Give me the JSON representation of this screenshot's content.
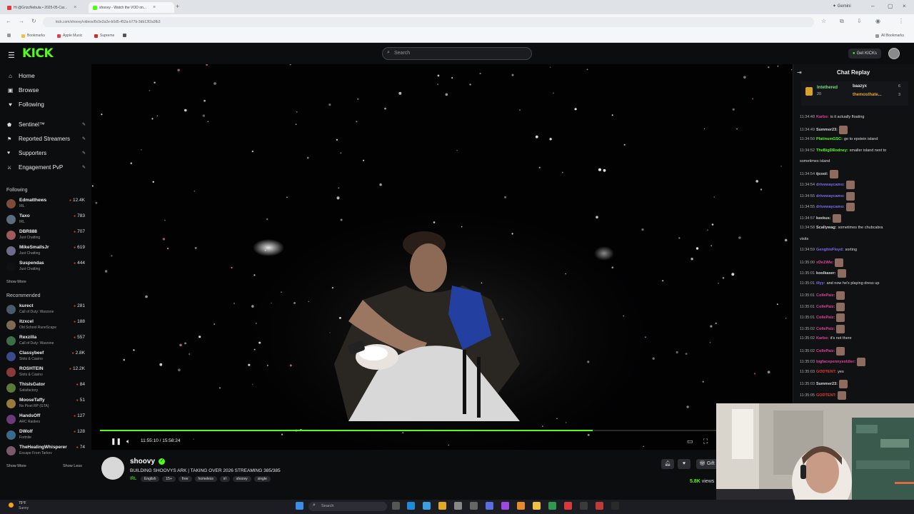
{
  "browser": {
    "tabs": [
      {
        "label": "Hi @GrizzNebula • 2025-05-Car..."
      },
      {
        "label": "shoovy - Watch the VOD on..."
      }
    ],
    "gemini_label": "Gemini",
    "url": "kick.com/shoovy/videos/8c0e2a2e-b0d5-452a-b77b-3db13f2a3fb3",
    "bookmarks": [
      "Bookmarks",
      "Apple Music",
      "Supreme"
    ],
    "all_bookmarks": "All Bookmarks"
  },
  "header": {
    "logo": "KICK",
    "search_placeholder": "Search",
    "get_kicks": "Get KICKs"
  },
  "sidebar": {
    "nav": [
      {
        "label": "Home",
        "icon": "home-icon"
      },
      {
        "label": "Browse",
        "icon": "browse-icon"
      },
      {
        "label": "Following",
        "icon": "heart-icon"
      }
    ],
    "extras": [
      {
        "label": "Sentinel™",
        "icon": "shield-icon"
      },
      {
        "label": "Reported Streamers",
        "icon": "flag-icon"
      },
      {
        "label": "Supporters",
        "icon": "heart-icon"
      },
      {
        "label": "Engagement PvP",
        "icon": "swords-icon"
      }
    ],
    "following_title": "Following",
    "following": [
      {
        "name": "Edmatthews",
        "category": "IRL",
        "viewers": "12.4K",
        "color": "#7a4e3a"
      },
      {
        "name": "Taxo",
        "category": "IRL",
        "viewers": "783",
        "color": "#5b6c7d"
      },
      {
        "name": "DBR888",
        "category": "Just Chatting",
        "viewers": "707",
        "color": "#a05a5a"
      },
      {
        "name": "MikeSmallsJr",
        "category": "Just Chatting",
        "viewers": "619",
        "color": "#6d6d8a"
      },
      {
        "name": "Suspendas",
        "category": "Just Chatting",
        "viewers": "444",
        "color": "#111111"
      }
    ],
    "show_more": "Show More",
    "recommended_title": "Recommended",
    "recommended": [
      {
        "name": "kurect",
        "category": "Call of Duty: Warzone",
        "viewers": "281",
        "color": "#4a5a6a"
      },
      {
        "name": "itzxcel",
        "category": "Old School RuneScape",
        "viewers": "188",
        "color": "#7d6a50"
      },
      {
        "name": "Rexzilla",
        "category": "Call of Duty: Warzone",
        "viewers": "557",
        "color": "#3c6e4a"
      },
      {
        "name": "Classybeef",
        "category": "Slots & Casino",
        "viewers": "2.8K",
        "color": "#3a4a8a"
      },
      {
        "name": "ROSHTEIN",
        "category": "Slots & Casino",
        "viewers": "12.2K",
        "color": "#8a3a3a"
      },
      {
        "name": "ThisIsGator",
        "category": "Satisfactory",
        "viewers": "84",
        "color": "#5a7a3a"
      },
      {
        "name": "MooseTaffy",
        "category": "No Pixel RP (GTA)",
        "viewers": "51",
        "color": "#9a7a3a"
      },
      {
        "name": "HandsOff",
        "category": "ARC Raiders",
        "viewers": "127",
        "color": "#6a3a7a"
      },
      {
        "name": "DWolf",
        "category": "Fortnite",
        "viewers": "128",
        "color": "#3a6a8a"
      },
      {
        "name": "TheHealingWhisperer",
        "category": "Escape From Tarkov",
        "viewers": "74",
        "color": "#7a5a6a"
      }
    ],
    "show_more_2": "Show More",
    "show_less": "Show Less"
  },
  "player": {
    "timecode": "11:55:10 / 15:58:24",
    "progress": 0.797
  },
  "stream": {
    "streamer": "shoovy",
    "title": "BUILDING SHOOVYS ARK | TAKING OVER 2026 STREAMING 385/385",
    "category": "IRL",
    "tags": [
      "English",
      "15+",
      "free",
      "homeless",
      "irl",
      "shoovy",
      "single"
    ],
    "gift_label": "Gift",
    "viewers_count": "5.8K",
    "viewers_label": "views"
  },
  "chat": {
    "title": "Chat Replay",
    "pinned": [
      {
        "user": "Intethered",
        "amount": "20"
      },
      {
        "user": "baazyx",
        "amount": "6"
      },
      {
        "user": "themosthate...",
        "amount": "3"
      }
    ],
    "messages": [
      {
        "time": "11:34:48",
        "user": "Karbo:",
        "color": "#e0409a",
        "text": "is it actually floating"
      },
      {
        "time": "11:34:49",
        "user": "Summer23:",
        "color": "#d8d8d8",
        "text": ""
      },
      {
        "time": "11:34:50",
        "user": "PlatinumGSC:",
        "color": "#53fc18",
        "text": "go to epstein island"
      },
      {
        "time": "11:34:52",
        "user": "TheBigDRodney:",
        "color": "#53fc18",
        "text": "smaller island next to"
      },
      {
        "time": "",
        "user": "",
        "color": "#d8d8d8",
        "text": "sometimes island"
      },
      {
        "time": "11:34:54",
        "user": "tjcool:",
        "color": "#d8d8d8",
        "text": ""
      },
      {
        "time": "11:34:54",
        "user": "drivewaycamo:",
        "color": "#7a6cf0",
        "text": ""
      },
      {
        "time": "11:34:55",
        "user": "drivewaycamo:",
        "color": "#7a6cf0",
        "text": ""
      },
      {
        "time": "11:34:55",
        "user": "drivewaycamo:",
        "color": "#7a6cf0",
        "text": ""
      },
      {
        "time": "11:34:57",
        "user": "keekus:",
        "color": "#d8d8d8",
        "text": ""
      },
      {
        "time": "11:34:58",
        "user": "Scallywag:",
        "color": "#d8d8d8",
        "text": "sometimes the chubcabra"
      },
      {
        "time": "",
        "user": "",
        "color": "#d8d8d8",
        "text": "visits"
      },
      {
        "time": "11:34:59",
        "user": "GenghisFloyd:",
        "color": "#7a6cf0",
        "text": "sorting"
      },
      {
        "time": "11:35:00",
        "user": "xDeZiMe:",
        "color": "#e0409a",
        "text": ""
      },
      {
        "time": "11:35:01",
        "user": "koolkaser:",
        "color": "#d8d8d8",
        "text": ""
      },
      {
        "time": "11:35:01",
        "user": "illyy:",
        "color": "#7a6cf0",
        "text": "and now he's playing dress up"
      },
      {
        "time": "11:35:01",
        "user": "CollePaiz:",
        "color": "#e0409a",
        "text": ""
      },
      {
        "time": "11:35:01",
        "user": "CollePaiz:",
        "color": "#e0409a",
        "text": ""
      },
      {
        "time": "11:35:01",
        "user": "CollePaiz:",
        "color": "#e0409a",
        "text": ""
      },
      {
        "time": "11:35:02",
        "user": "CollePaiz:",
        "color": "#e0409a",
        "text": ""
      },
      {
        "time": "11:35:02",
        "user": "Karbo:",
        "color": "#e0409a",
        "text": "it's not there"
      },
      {
        "time": "11:35:02",
        "user": "CollePaiz:",
        "color": "#e0409a",
        "text": ""
      },
      {
        "time": "11:35:03",
        "user": "bigfacepennysoldier:",
        "color": "#e0409a",
        "text": ""
      },
      {
        "time": "11:35:03",
        "user": "GODTENT:",
        "color": "#e53935",
        "text": "yes"
      },
      {
        "time": "11:35:03",
        "user": "Summer23:",
        "color": "#d8d8d8",
        "text": ""
      },
      {
        "time": "11:35:05",
        "user": "GODTENT:",
        "color": "#e53935",
        "text": ""
      }
    ]
  },
  "taskbar": {
    "weather_temp": "75°F",
    "weather_desc": "Sunny",
    "search_placeholder": "Search"
  }
}
